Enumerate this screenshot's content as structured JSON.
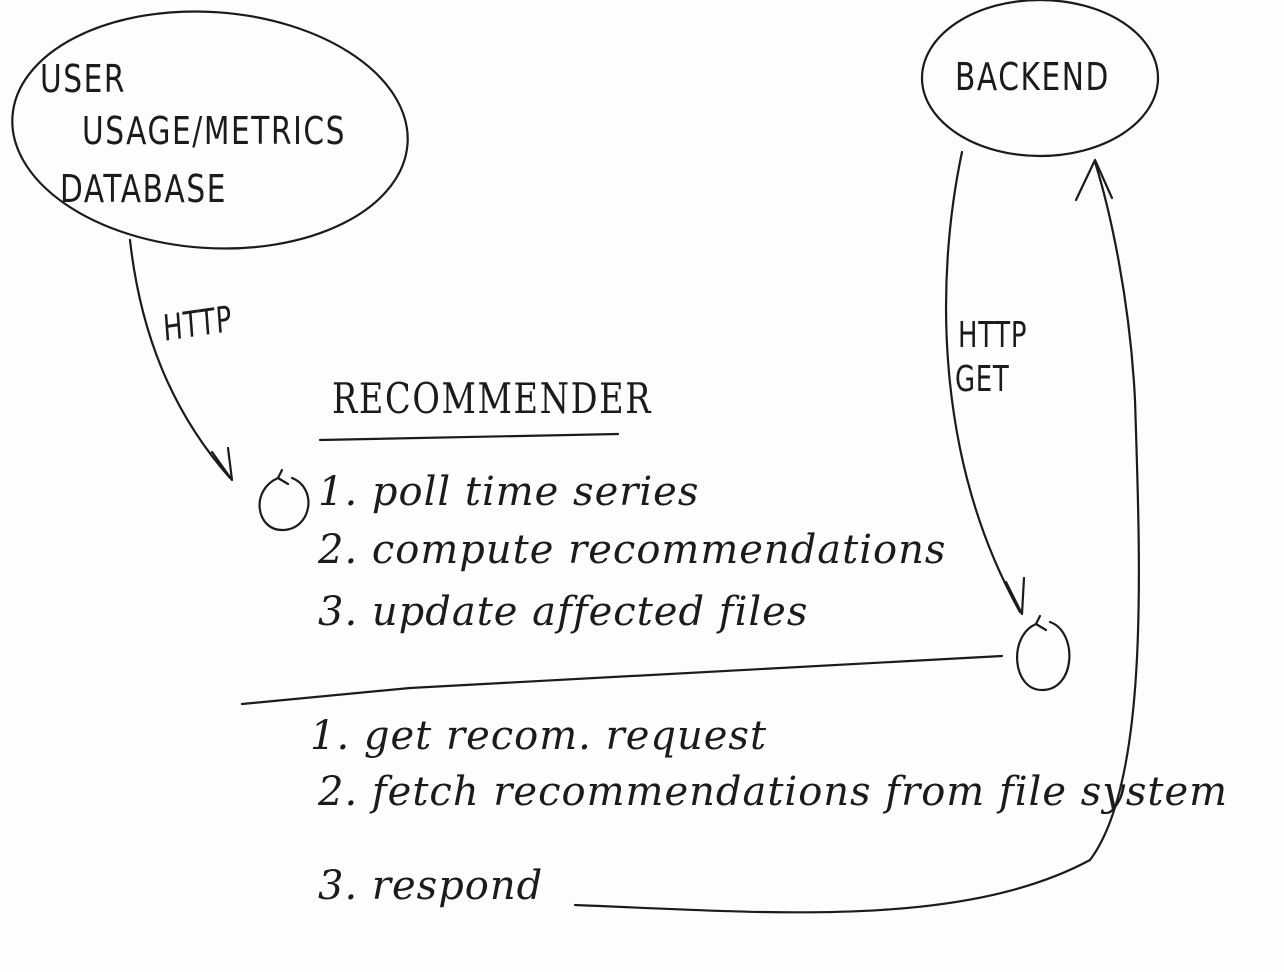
{
  "nodes": {
    "database": {
      "line1": "USER",
      "line2": "USAGE/METRICS",
      "line3": "DATABASE"
    },
    "backend": {
      "label": "BACKEND"
    }
  },
  "edges": {
    "database_to_recommender": "HTTP",
    "backend_to_recommender": {
      "line1": "HTTP",
      "line2": "GET"
    }
  },
  "recommender": {
    "title": "RECOMMENDER",
    "loop_steps": [
      "1. poll time series",
      "2. compute recommendations",
      "3. update affected files"
    ],
    "request_steps": [
      "1. get recom. request",
      "2. fetch recommendations from file system",
      "3. respond"
    ]
  }
}
